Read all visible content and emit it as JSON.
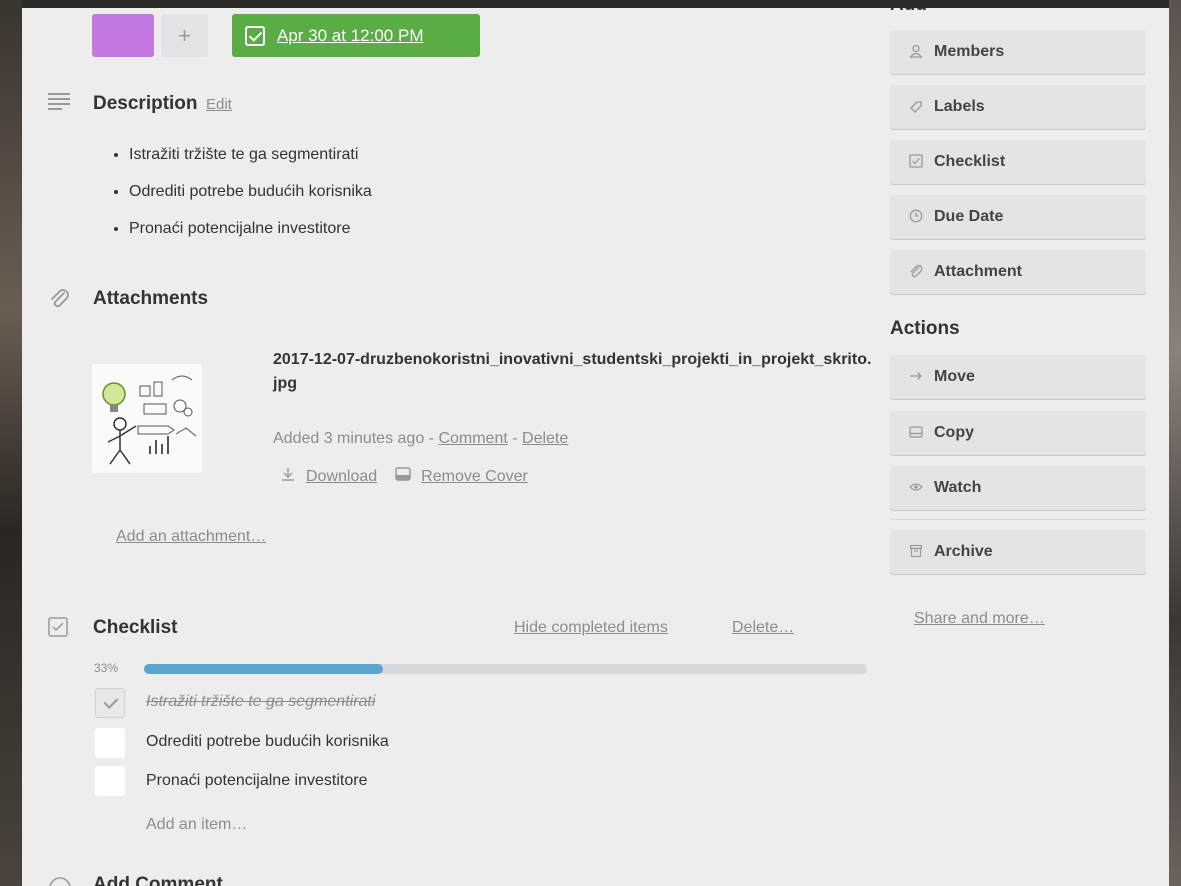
{
  "card": {
    "due_date": "Apr 30 at 12:00 PM",
    "add_label_symbol": "+",
    "label_color": "#c377e0"
  },
  "description": {
    "title": "Description",
    "edit_label": "Edit",
    "items": [
      "Istražiti tržište te ga segmentirati",
      "Odrediti potrebe budućih korisnika",
      "Pronaći potencijalne investitore"
    ]
  },
  "attachments": {
    "title": "Attachments",
    "file_name": "2017-12-07-druzbenokoristni_inovativni_studentski_projekti_in_projekt_skrito.jpg",
    "added_text": "Added 3 minutes ago - ",
    "separator": " - ",
    "comment_label": "Comment",
    "delete_label": "Delete",
    "download_label": "Download",
    "remove_cover_label": "Remove Cover",
    "add_attachment_label": "Add an attachment…"
  },
  "checklist": {
    "title": "Checklist",
    "hide_completed_label": "Hide completed items",
    "delete_label": "Delete…",
    "progress_label": "33%",
    "progress_fraction": 0.33,
    "progress_color": "#5ba4cf",
    "items": [
      {
        "text": "Istražiti tržište te ga segmentirati",
        "checked": true
      },
      {
        "text": "Odrediti potrebe budućih korisnika",
        "checked": false
      },
      {
        "text": "Pronaći potencijalne investitore",
        "checked": false
      }
    ],
    "add_item_label": "Add an item…"
  },
  "add_comment": {
    "title": "Add Comment"
  },
  "sidebar": {
    "add_heading": "Add",
    "add_buttons": [
      {
        "label": "Members",
        "icon": "person-icon"
      },
      {
        "label": "Labels",
        "icon": "tag-icon"
      },
      {
        "label": "Checklist",
        "icon": "checkbox-icon"
      },
      {
        "label": "Due Date",
        "icon": "clock-icon"
      },
      {
        "label": "Attachment",
        "icon": "paperclip-icon"
      }
    ],
    "actions_heading": "Actions",
    "action_buttons": [
      {
        "label": "Move",
        "icon": "arrow-right-icon"
      },
      {
        "label": "Copy",
        "icon": "copy-icon"
      },
      {
        "label": "Watch",
        "icon": "eye-icon"
      }
    ],
    "archive_label": "Archive",
    "share_label": "Share and more…"
  },
  "colors": {
    "due_green": "#5aac44",
    "card_background": "#ededed"
  }
}
